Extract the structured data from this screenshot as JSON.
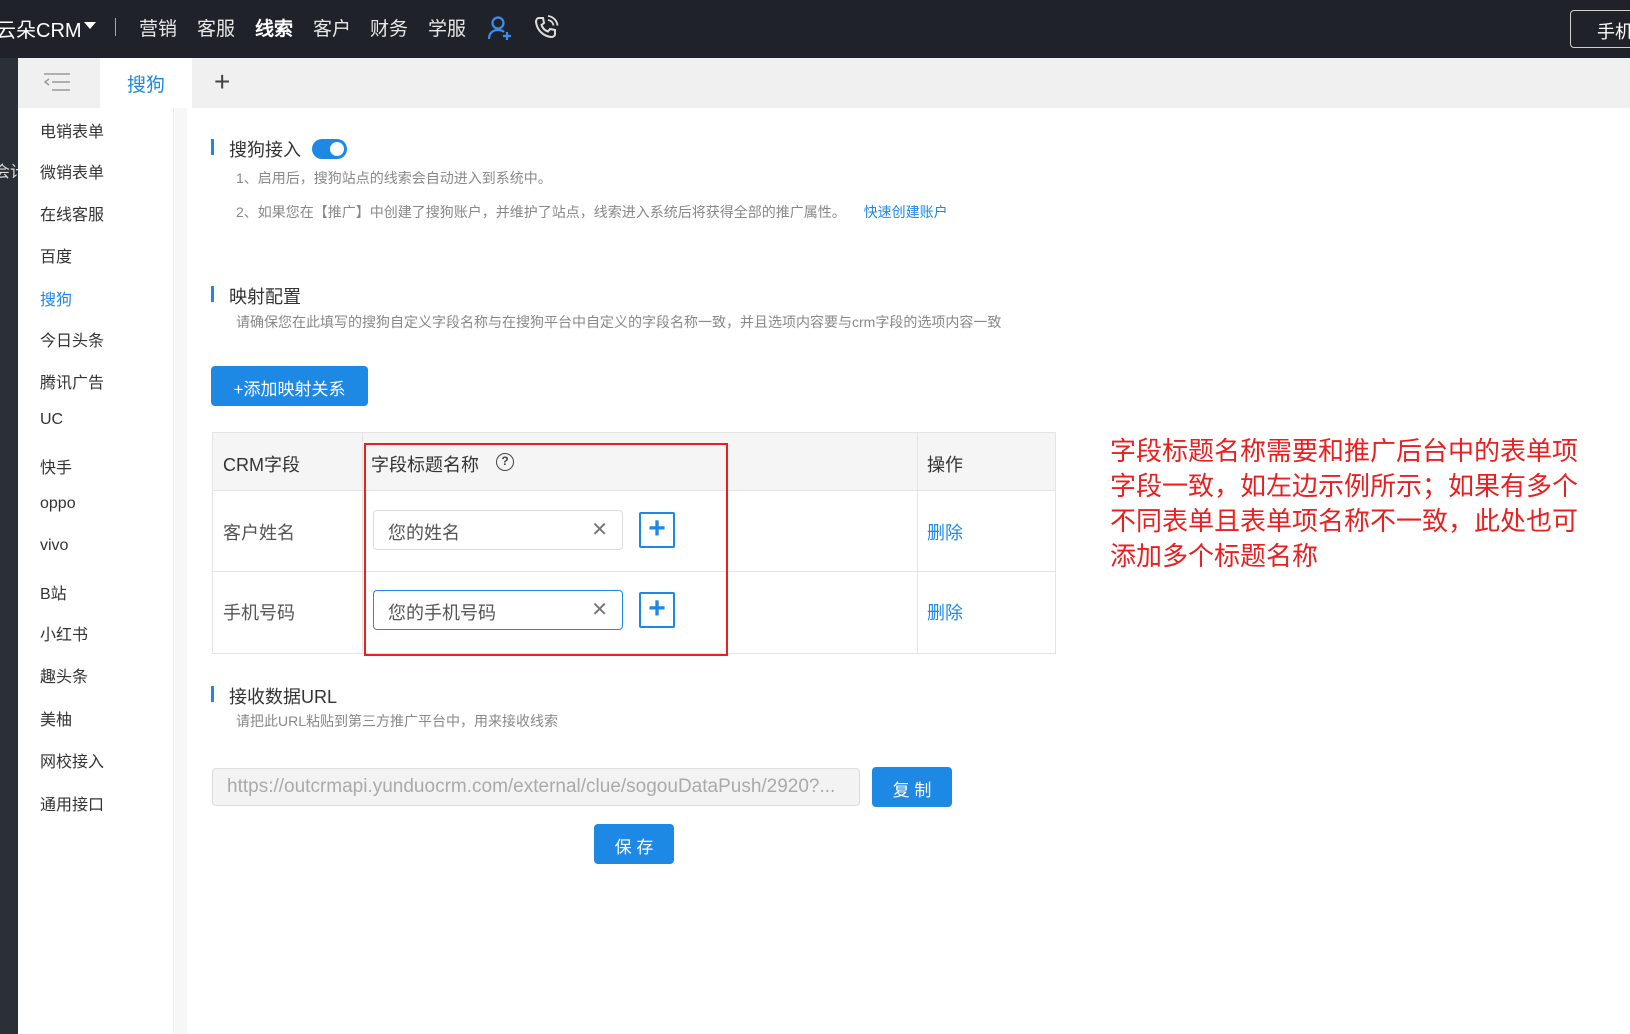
{
  "topbar": {
    "brand": "云朵CRM",
    "nav": [
      "营销",
      "客服",
      "线索",
      "客户",
      "财务",
      "学服"
    ],
    "active_nav": "线索",
    "right_button": "手机"
  },
  "leftstrip": {
    "text": "会计"
  },
  "tabs": {
    "active": "搜狗",
    "add": "+"
  },
  "submenu": {
    "items": [
      "电销表单",
      "微销表单",
      "在线客服",
      "百度",
      "搜狗",
      "今日头条",
      "腾讯广告",
      "UC",
      "快手",
      "oppo",
      "vivo",
      "B站",
      "小红书",
      "趣头条",
      "美柚",
      "网校接入",
      "通用接口"
    ],
    "active": "搜狗"
  },
  "sogou_access": {
    "title": "搜狗接入",
    "enabled": true,
    "note1": "1、启用后，搜狗站点的线索会自动进入到系统中。",
    "note2": "2、如果您在【推广】中创建了搜狗账户，并维护了站点，线索进入系统后将获得全部的推广属性。",
    "quick_link": "快速创建账户"
  },
  "mapping": {
    "title": "映射配置",
    "note": "请确保您在此填写的搜狗自定义字段名称与在搜狗平台中自定义的字段名称一致，并且选项内容要与crm字段的选项内容一致",
    "add_button": "+添加映射关系",
    "columns": [
      "CRM字段",
      "字段标题名称",
      "操作"
    ],
    "help_icon": "?",
    "rows": [
      {
        "crm_field": "客户姓名",
        "title_value": "您的姓名",
        "action": "删除"
      },
      {
        "crm_field": "手机号码",
        "title_value": "您的手机号码",
        "action": "删除"
      }
    ]
  },
  "annotation": "字段标题名称需要和推广后台中的表单项字段一致，如左边示例所示；如果有多个不同表单且表单项名称不一致，此处也可添加多个标题名称",
  "receive_url": {
    "title": "接收数据URL",
    "note": "请把此URL粘贴到第三方推广平台中，用来接收线索",
    "url": "https://outcrmapi.yunduocrm.com/external/clue/sogouDataPush/2920?...",
    "copy_button": "复 制"
  },
  "save_button": "保 存",
  "colors": {
    "primary": "#1e88e5",
    "topbar": "#1f2329",
    "annotation": "#e82020"
  },
  "icons": [
    "add-user-icon",
    "phone-icon",
    "menu-collapse-icon",
    "help-icon",
    "clear-icon",
    "plus-icon"
  ]
}
